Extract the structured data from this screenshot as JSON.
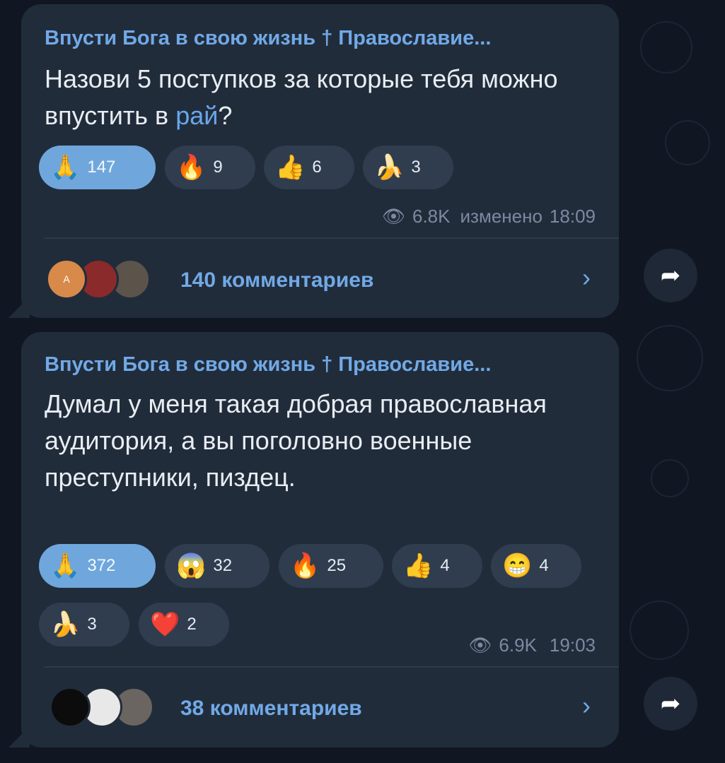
{
  "posts": [
    {
      "channel": "Впусти Бога в свою жизнь † Православие...",
      "text_before_link": "Назови 5 поступков за которые тебя можно впустить в ",
      "link_text": "рай",
      "text_after_link": "?",
      "reactions": [
        {
          "emoji": "🙏",
          "count": "147",
          "active": true
        },
        {
          "emoji": "🔥",
          "count": "9",
          "active": false
        },
        {
          "emoji": "👍",
          "count": "6",
          "active": false
        },
        {
          "emoji": "🍌",
          "count": "3",
          "active": false
        }
      ],
      "views": "6.8K",
      "edited_label": "изменено",
      "time": "18:09",
      "avatar_letter": "A",
      "comments_label": "140 комментариев"
    },
    {
      "channel": "Впусти Бога в свою жизнь † Православие...",
      "text": "Думал у меня такая добрая православная аудитория, а вы поголовно военные преступники, пиздец.",
      "reactions": [
        {
          "emoji": "🙏",
          "count": "372",
          "active": true
        },
        {
          "emoji": "😱",
          "count": "32",
          "active": false
        },
        {
          "emoji": "🔥",
          "count": "25",
          "active": false
        },
        {
          "emoji": "👍",
          "count": "4",
          "active": false
        },
        {
          "emoji": "😁",
          "count": "4",
          "active": false
        },
        {
          "emoji": "🍌",
          "count": "3",
          "active": false
        },
        {
          "emoji": "❤️",
          "count": "2",
          "active": false
        }
      ],
      "views": "6.9K",
      "time": "19:03",
      "comments_label": "38 комментариев"
    }
  ],
  "icons": {
    "eye": "👁",
    "chevron": "›",
    "share": "➦"
  },
  "colors": {
    "background": "#101722",
    "bubble": "#212c3b",
    "accent": "#71a9e6",
    "active_reaction": "#6fa7dc"
  }
}
